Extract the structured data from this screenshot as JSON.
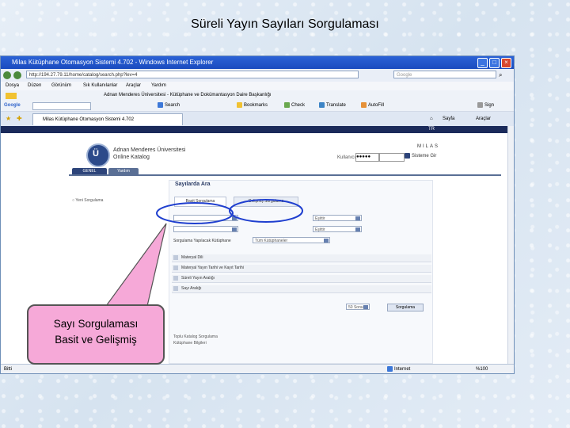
{
  "slide": {
    "title": "Süreli Yayın Sayıları Sorgulaması",
    "callout_line1": "Sayı Sorgulaması",
    "callout_line2": "Basit ve Gelişmiş"
  },
  "browser": {
    "window_title": "Milas Kütüphane Otomasyon Sistemi 4.702 - Windows Internet Explorer",
    "address": "http://194.27.79.11/home/catalog/search.php?lev=4",
    "search_placeholder": "Google",
    "menu": [
      "Dosya",
      "Düzen",
      "Görünüm",
      "Sık Kullanılanlar",
      "Araçlar",
      "Yardım"
    ],
    "links_bar": [
      "Adnan Menderes Üniversitesi - Kütüphane ve Dokümantasyon Daire Başkanlığı"
    ],
    "toolbar": [
      "Google",
      "Search",
      "Bookmarks",
      "Check",
      "Translate",
      "AutoFill",
      "Sign In"
    ],
    "tab_label": "Milas Kütüphane Otomasyon Sistemi 4.702",
    "tab_tools": [
      "Sayfa",
      "Araçlar"
    ],
    "status_left": "Bitti",
    "status_zone": "Internet",
    "status_zoom": "%100"
  },
  "page": {
    "lang": "TR",
    "logo_letter": "Ü",
    "university_line1": "Adnan Menderes Üniversitesi",
    "university_line2": "Online Katalog",
    "brand": "MILAS",
    "login_label": "Kullanıcı Adı",
    "password_mask": "●●●●●",
    "login_button": "Sisteme Gir",
    "nav_tabs": [
      "GENEL",
      "Yardım"
    ],
    "panel_title": "Sayılarda Ara",
    "new_query": "Yeni Sorgulama",
    "simple_tab": "Basit Sorgulama",
    "advanced_tab": "Gelişmiş Sorgulama",
    "selects": [
      "",
      "",
      "Eşittir",
      "Eşittir"
    ],
    "filter_label": "Sorgulama Yapılacak Kütüphane",
    "filter_value": "Tüm Kütüphaneler",
    "accordion": [
      "Materyal Dili",
      "Materyal Yayın Tarihi ve Kayıt Tarihi",
      "Süreli Yayın Aralığı",
      "Sayı Aralığı"
    ],
    "per_page": "50 Sonuç",
    "search_button": "Sorgulama",
    "bottom_links": [
      "Toplu Katalog Sorgulama",
      "Kütüphane Bilgileri"
    ]
  },
  "colors": {
    "callout_fill": "#f6a9d8",
    "highlight": "#1f3fcf",
    "titlebar": "#2b62d6"
  }
}
